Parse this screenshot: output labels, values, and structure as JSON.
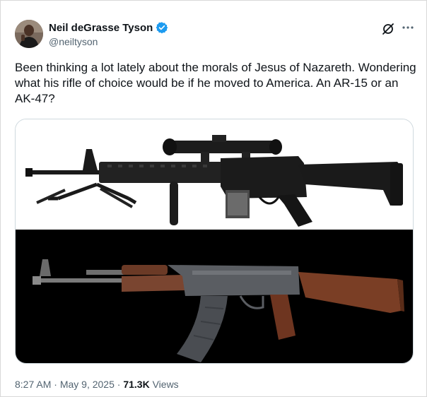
{
  "author": {
    "display_name": "Neil deGrasse Tyson",
    "handle": "@neiltyson",
    "verified": true,
    "verified_color": "#1d9bf0"
  },
  "tweet": {
    "text": "Been thinking a lot lately about the morals of Jesus of Nazareth. Wondering what his rifle of choice would be if he moved to America. An AR-15 or an AK-47?"
  },
  "media": {
    "images": [
      {
        "subject": "ar15-rifle-icon",
        "background": "#ffffff"
      },
      {
        "subject": "ak47-rifle-icon",
        "background": "#000000"
      }
    ]
  },
  "meta": {
    "time": "8:27 AM",
    "separator1": " · ",
    "date": "May 9, 2025",
    "separator2": " · ",
    "views_count": "71.3K",
    "views_label": " Views"
  },
  "actions": {
    "grok_icon": "grok-icon",
    "more_icon": "more-icon"
  }
}
